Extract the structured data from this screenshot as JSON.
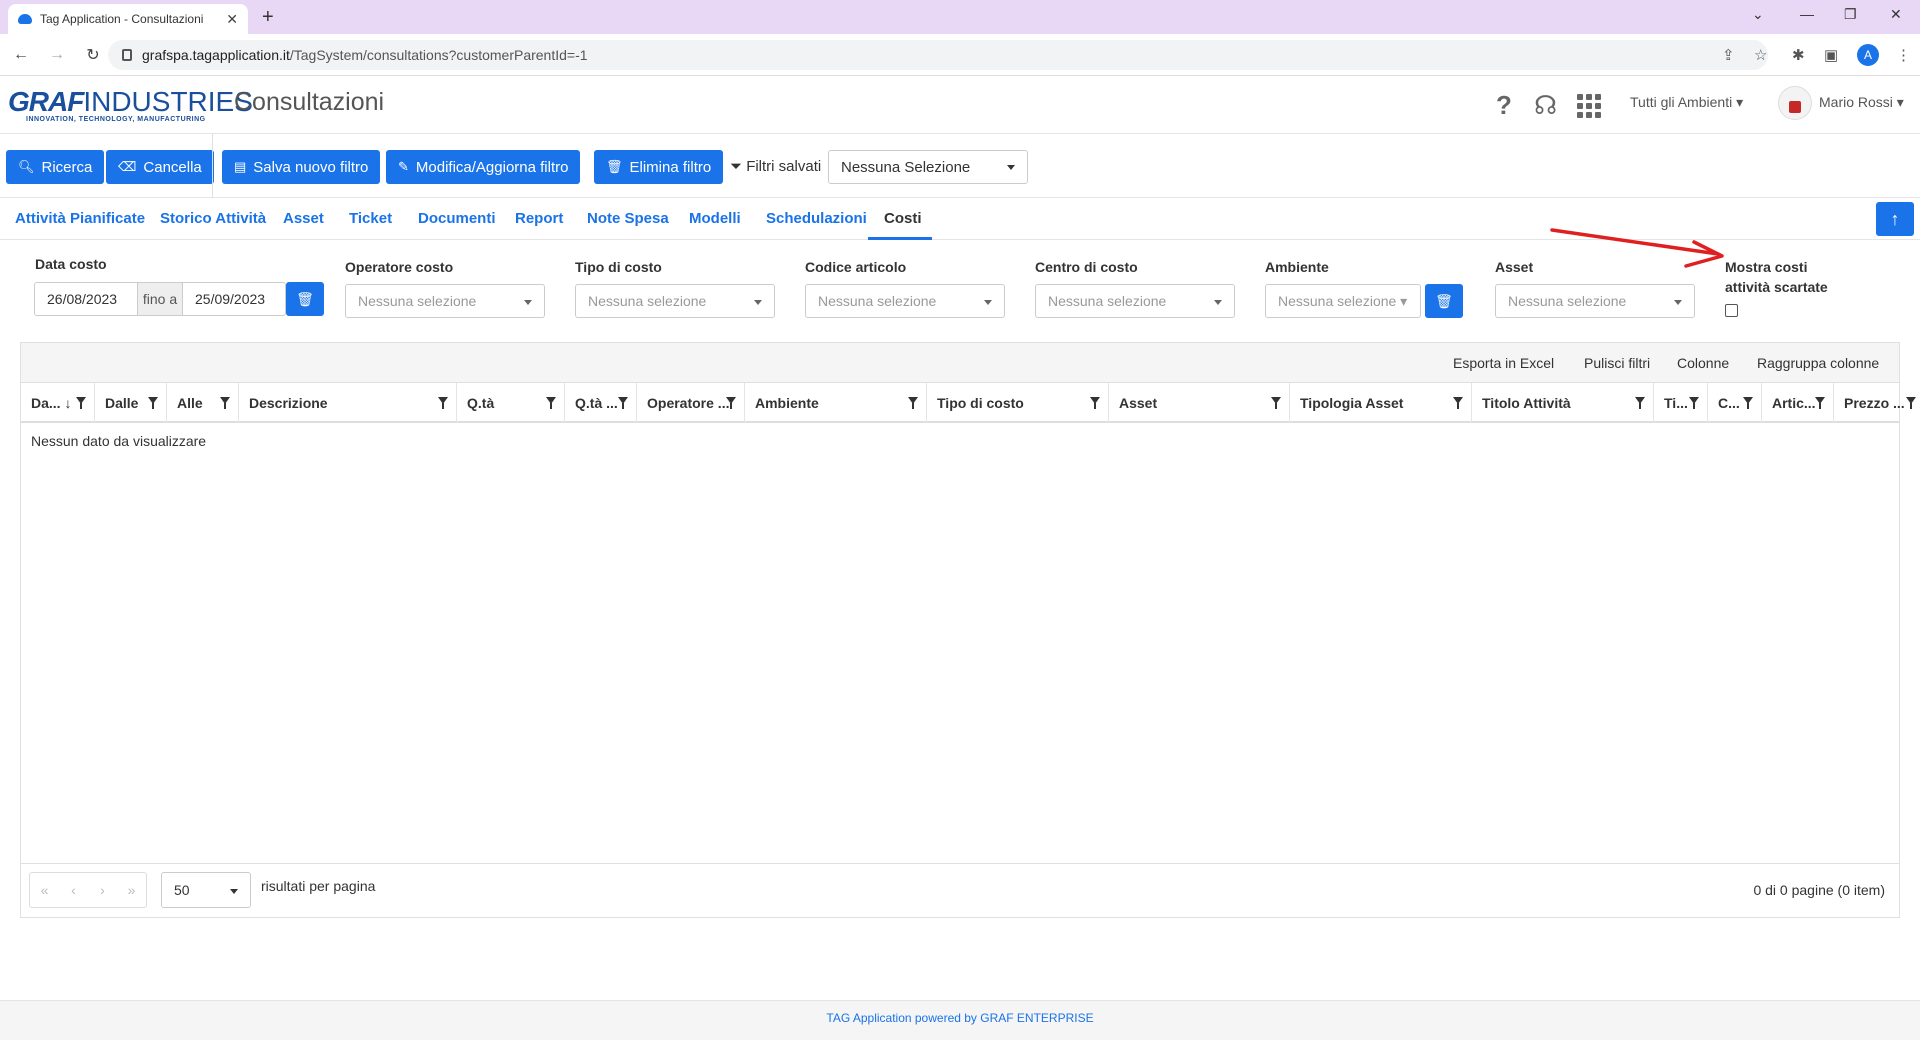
{
  "browser": {
    "tab_title": "Tag Application - Consultazioni",
    "url_host": "grafspa.tagapplication.it",
    "url_path": "/TagSystem/consultations?customerParentId=-1",
    "profile_initial": "A"
  },
  "header": {
    "logo_graf": "GRAF",
    "logo_industries": "INDUSTRIES",
    "logo_tagline": "INNOVATION, TECHNOLOGY, MANUFACTURING",
    "page_title": "Consultazioni",
    "environment_select": "Tutti gli Ambienti",
    "user_name": "Mario Rossi"
  },
  "toolbar": {
    "search": "Ricerca",
    "cancel": "Cancella",
    "save_filter": "Salva nuovo filtro",
    "edit_filter": "Modifica/Aggiorna filtro",
    "delete_filter": "Elimina filtro",
    "saved_filters_label": "Filtri salvati",
    "saved_filters_value": "Nessuna Selezione"
  },
  "tabs": [
    "Attività Pianificate",
    "Storico Attività",
    "Asset",
    "Ticket",
    "Documenti",
    "Report",
    "Note Spesa",
    "Modelli",
    "Schedulazioni",
    "Costi"
  ],
  "active_tab": "Costi",
  "filters": {
    "date_label": "Data costo",
    "date_from": "26/08/2023",
    "date_sep": "fino a",
    "date_to": "25/09/2023",
    "operator_label": "Operatore costo",
    "cost_type_label": "Tipo di costo",
    "article_label": "Codice articolo",
    "cost_center_label": "Centro di costo",
    "environment_label": "Ambiente",
    "asset_label": "Asset",
    "placeholder": "Nessuna selezione",
    "show_discarded_line1": "Mostra costi",
    "show_discarded_line2": "attività scartate",
    "show_discarded_checked": false
  },
  "grid": {
    "toolbar": [
      "Esporta in Excel",
      "Pulisci filtri",
      "Colonne",
      "Raggruppa colonne"
    ],
    "columns": [
      "Da... ↓",
      "Dalle",
      "Alle",
      "Descrizione",
      "Q.tà",
      "Q.tà ...",
      "Operatore ...",
      "Ambiente",
      "Tipo di costo",
      "Asset",
      "Tipologia Asset",
      "Titolo Attività",
      "Ti...",
      "C...",
      "Artic...",
      "Prezzo ..."
    ],
    "empty_message": "Nessun dato da visualizzare",
    "page_size": "50",
    "per_page_label": "risultati per pagina",
    "page_info": "0 di 0 pagine (0 item)"
  },
  "footer": "TAG Application powered by GRAF ENTERPRISE",
  "colors": {
    "primary": "#1a73e8",
    "annotation": "#e02020"
  }
}
